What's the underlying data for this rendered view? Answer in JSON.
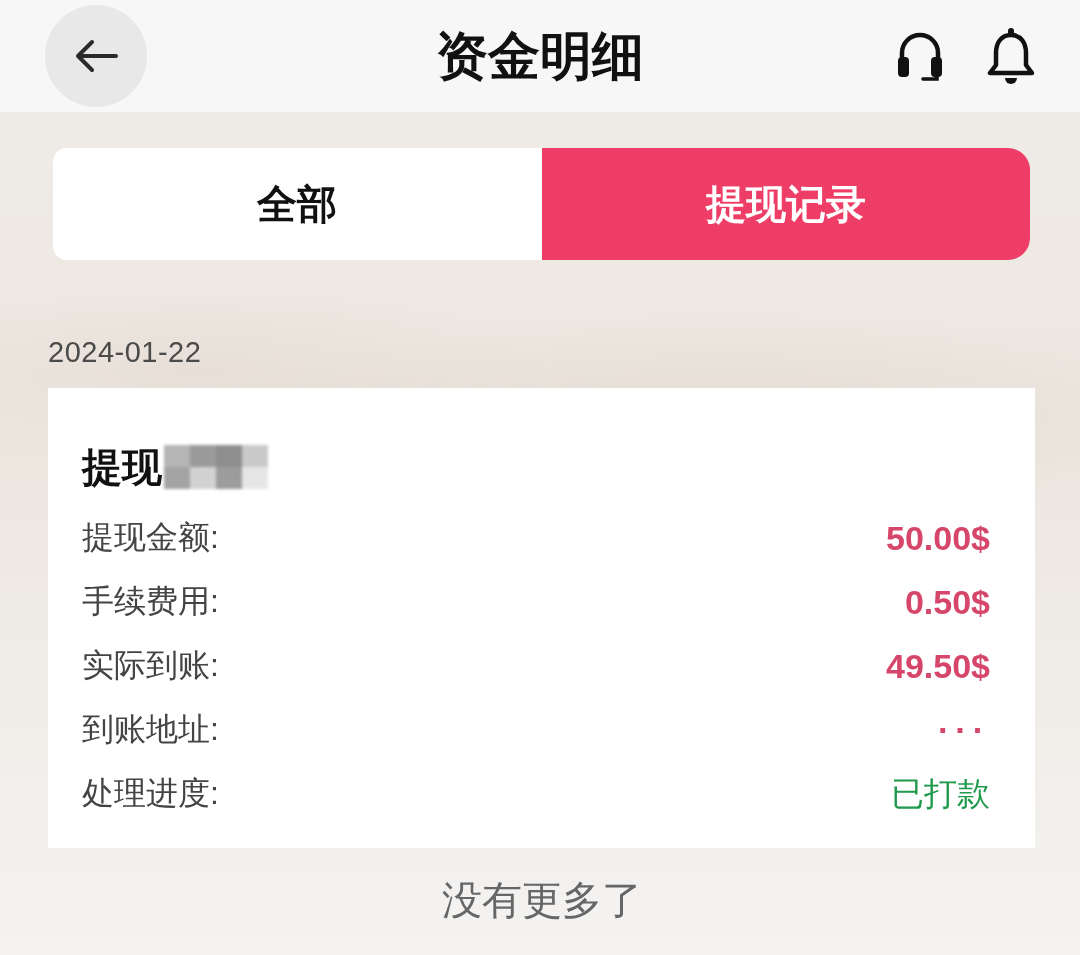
{
  "header": {
    "title": "资金明细"
  },
  "tabs": [
    {
      "label": "全部",
      "selected": false
    },
    {
      "label": "提现记录",
      "selected": true
    }
  ],
  "records": [
    {
      "date": "2024-01-22",
      "title": "提现",
      "title_redacted": true,
      "fields": [
        {
          "label": "提现金额:",
          "value": "50.00$",
          "color": "#d6456a"
        },
        {
          "label": "手续费用:",
          "value": "0.50$",
          "color": "#d6456a"
        },
        {
          "label": "实际到账:",
          "value": "49.50$",
          "color": "#d6456a"
        },
        {
          "label": "到账地址:",
          "value": "···",
          "color": "#d6456a"
        },
        {
          "label": "处理进度:",
          "value": "已打款",
          "color": "#1f9a4c"
        }
      ]
    }
  ],
  "footer": "没有更多了"
}
